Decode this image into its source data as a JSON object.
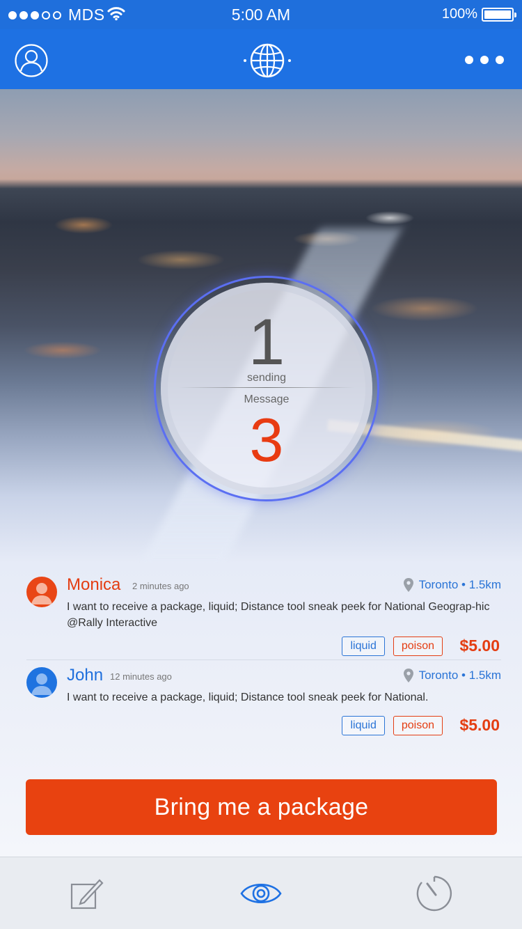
{
  "status_bar": {
    "carrier": "MDS",
    "time": "5:00 AM",
    "battery": "100%",
    "signal_bars_filled": 3,
    "signal_bars_total": 5
  },
  "nav": {
    "left_icon": "profile-icon",
    "center_icon": "globe-icon",
    "right_icon": "more-icon"
  },
  "counter": {
    "sending_count": "1",
    "sending_label": "sending",
    "message_label": "Message",
    "message_count": "3"
  },
  "feed": [
    {
      "name": "Monica",
      "time_ago": "2 minutes ago",
      "location": "Toronto • 1.5km",
      "text": "I want to receive a package, liquid; Distance tool sneak peek for National Geograp-hic @Rally Interactive",
      "tags": [
        "liquid",
        "poison"
      ],
      "price": "$5.00",
      "avatar_color": "#e94616"
    },
    {
      "name": "John",
      "time_ago": "12 minutes ago",
      "location": "Toronto • 1.5km",
      "text": "I want to receive a package, liquid; Distance tool sneak peek for National.",
      "tags": [
        "liquid",
        "poison"
      ],
      "price": "$5.00",
      "avatar_color": "#1f73e0"
    }
  ],
  "cta": {
    "label": "Bring me a package"
  },
  "tab_bar": {
    "items": [
      "compose-icon",
      "eye-icon",
      "timer-icon"
    ],
    "active": "eye-icon"
  },
  "colors": {
    "brand_blue": "#1e71e3",
    "accent_orange": "#e84210"
  }
}
